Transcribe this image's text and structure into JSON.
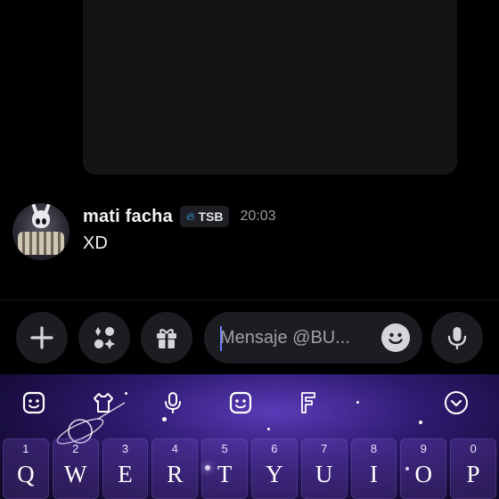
{
  "message": {
    "author": "mati facha",
    "tag": "TSB",
    "timestamp": "20:03",
    "text": "XD"
  },
  "composer": {
    "placeholder": "Mensaje @BU..."
  },
  "keyboard": {
    "keys": [
      {
        "num": "1",
        "letter": "Q"
      },
      {
        "num": "2",
        "letter": "W"
      },
      {
        "num": "3",
        "letter": "E"
      },
      {
        "num": "4",
        "letter": "R"
      },
      {
        "num": "5",
        "letter": "T"
      },
      {
        "num": "6",
        "letter": "Y"
      },
      {
        "num": "7",
        "letter": "U"
      },
      {
        "num": "8",
        "letter": "I"
      },
      {
        "num": "9",
        "letter": "O"
      },
      {
        "num": "0",
        "letter": "P"
      }
    ],
    "toolbar": [
      "emoji-sticker-icon",
      "clipboard-icon",
      "microphone-icon",
      "emoji-icon",
      "font-icon",
      "collapse-icon"
    ]
  },
  "colors": {
    "background": "#000000",
    "surface": "#1c1d22",
    "tag_flame": "#3fb4ff",
    "caret": "#6d7bff",
    "keyboard_theme": "#5b3bb8"
  }
}
